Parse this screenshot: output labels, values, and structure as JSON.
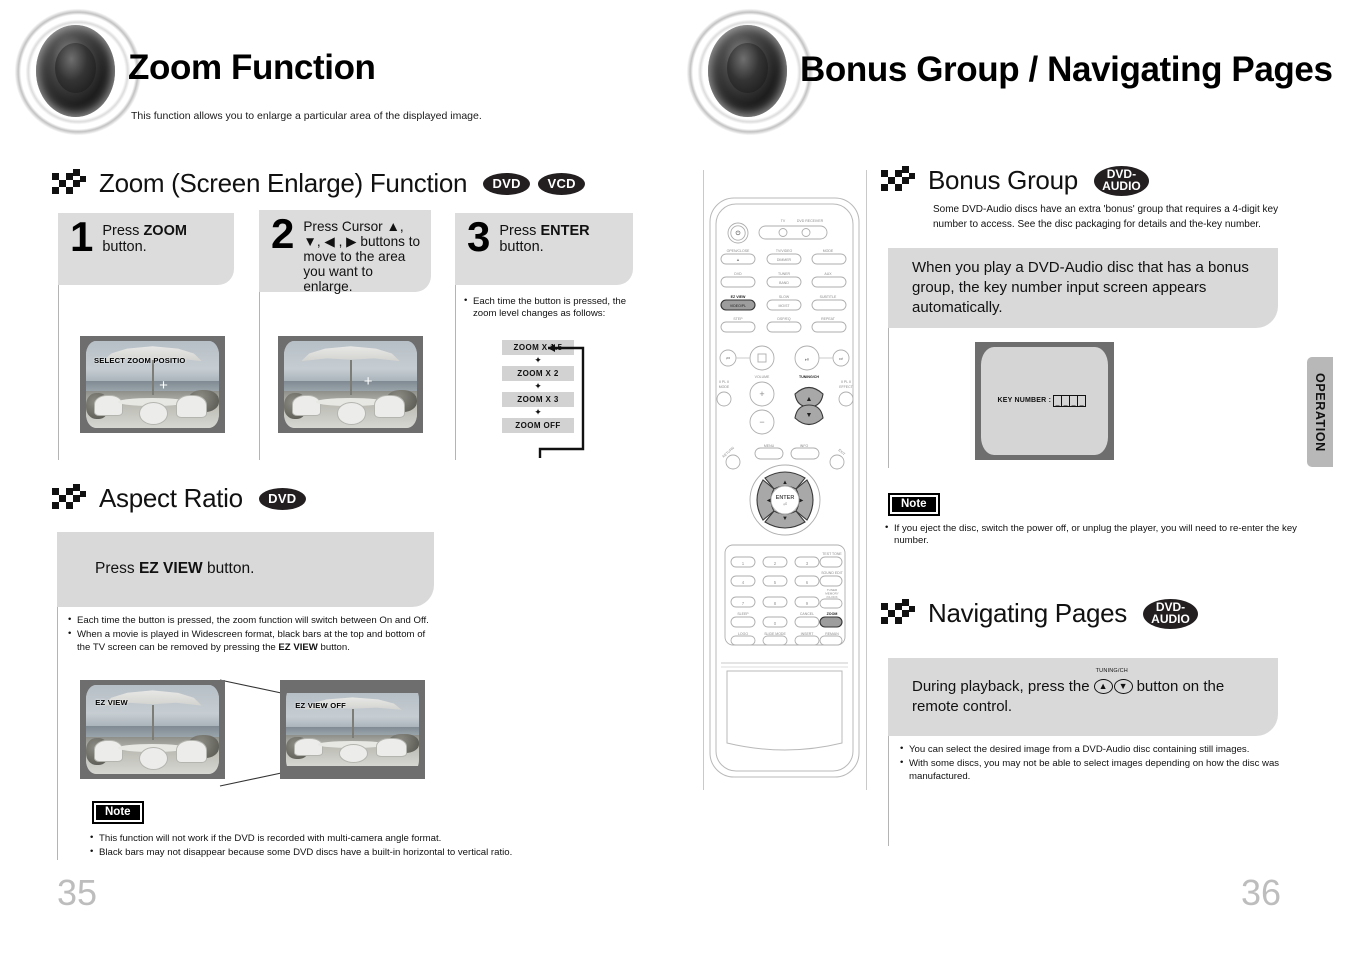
{
  "left_page": {
    "title": "Zoom Function",
    "subtitle": "This function allows you to enlarge a particular area of the displayed image.",
    "page_number": "35",
    "section_zoom": {
      "heading": "Zoom (Screen Enlarge) Function",
      "badges": [
        "DVD",
        "VCD"
      ],
      "steps": [
        {
          "number": "1",
          "text_pre": "Press ",
          "text_bold": "ZOOM",
          "text_post": " button."
        },
        {
          "number": "2",
          "text_pre": "Press Cursor ▲, ▼, ◀ , ▶ buttons to move to the area you want to enlarge.",
          "text_bold": "",
          "text_post": ""
        },
        {
          "number": "3",
          "text_pre": "Press ",
          "text_bold": "ENTER",
          "text_post": " button."
        }
      ],
      "step3_bullet": "Each time the button is pressed, the zoom level changes as follows:",
      "zoom_levels": [
        "ZOOM X 1.5",
        "ZOOM X 2",
        "ZOOM X 3",
        "ZOOM  OFF"
      ],
      "screen1_label": "SELECT ZOOM POSITIO",
      "screen2_label": ""
    },
    "section_aspect": {
      "heading": "Aspect Ratio",
      "badges": [
        "DVD"
      ],
      "panel_pre": "Press ",
      "panel_bold": "EZ VIEW",
      "panel_post": " button.",
      "bullets": [
        {
          "pre": "Each time the button is pressed, the zoom function will switch between On and Off.",
          "bold": "",
          "post": ""
        },
        {
          "pre": "When a movie is played in Widescreen format, black bars at the top and bottom of the TV screen can be removed by pressing the ",
          "bold": "EZ VIEW",
          "post": " button."
        }
      ],
      "image_label_left": "EZ VIEW",
      "image_label_right": "EZ VIEW OFF",
      "note_label": "Note",
      "note_bullets": [
        "This function will not work if the DVD is recorded with multi-camera angle format.",
        "Black bars may not disappear because some DVD discs have a built-in horizontal to vertical ratio."
      ]
    }
  },
  "right_page": {
    "title": "Bonus Group / Navigating Pages",
    "page_number": "36",
    "side_tab": "OPERATION",
    "section_bonus": {
      "heading": "Bonus Group",
      "badge": "DVD-AUDIO",
      "intro": "Some DVD-Audio discs have an extra 'bonus' group that requires a 4-digit key number to access. See the disc packaging for details and the-key number.",
      "panel_text": "When you play a DVD-Audio disc that has a bonus group, the key number input screen appears automatically.",
      "screen_label": "KEY NUMBER :",
      "screen_digits": [
        "_",
        "_",
        "_",
        "_"
      ],
      "note_label": "Note",
      "note_bullets": [
        "If you eject the disc, switch the power off, or unplug the player, you will need to re-enter the key number."
      ]
    },
    "section_navigating": {
      "heading": "Navigating Pages",
      "badge": "DVD-AUDIO",
      "panel_pre": "During playback, press the",
      "panel_post": "button on the remote control.",
      "tuning_caption": "TUNING/CH",
      "bullets": [
        "You can select the desired image from a DVD-Audio disc containing still images.",
        "With some discs, you may not be able to select images depending on how the disc was manufactured."
      ]
    },
    "remote": {
      "power_group": {
        "tv": "TV",
        "dvd_receiver": "DVD RECEIVER"
      },
      "row1": [
        "OPEN/CLOSE",
        "TV/VIDEO",
        "MODE"
      ],
      "row1_btn": [
        "",
        "DIMMER",
        ""
      ],
      "row2": [
        "DVD",
        "TUNER",
        "AUX"
      ],
      "row2_btn": [
        "",
        "BAND",
        ""
      ],
      "row3": [
        "EZ VIEW",
        "SLOW",
        "SUBTITLE"
      ],
      "row3_btn": [
        "VIDEO/PL",
        "MO/ST",
        ""
      ],
      "row4": [
        "STEP",
        "DSP/EQ",
        "REPEAT"
      ],
      "volume_label": "VOLUME",
      "tuning_label": "TUNING/CH",
      "mode_label": "MODE",
      "effect_label": "EFFECT",
      "enter_label": "ENTER",
      "menu_label": "MENU",
      "info_label": "INFO",
      "return_label": "RETURN",
      "exit_label": "EXIT",
      "keypad": [
        "1",
        "2",
        "3",
        "4",
        "5",
        "6",
        "7",
        "8",
        "9",
        "0"
      ],
      "keypad_side": [
        "TEST TONE",
        "SOUND EDIT",
        "TUNER MEMORY/CLOCK"
      ],
      "keypad_bottom_labels": [
        "SLEEP",
        "CANCEL",
        "ZOOM"
      ],
      "keypad_last_row": [
        "LOGO",
        "SLIDE MODE",
        "INSERT",
        "REMAIN"
      ],
      "highlighted": [
        "EZ VIEW",
        "TUNING/CH",
        "ZOOM"
      ]
    }
  },
  "colors": {
    "panel_grey": "#d9d9d9",
    "step_grey": "#dcdcdc",
    "badge_dark": "#231f20",
    "tab_grey": "#b8b8b8",
    "page_no_grey": "#bdbdbd",
    "tv_bezel": "#6e6e6e"
  }
}
